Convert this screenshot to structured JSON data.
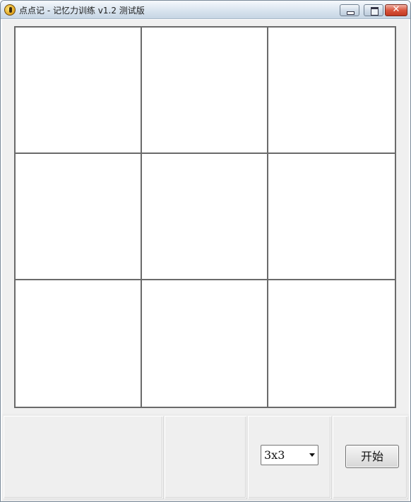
{
  "window": {
    "title": "点点记 - 记忆力训练 v1.2 测试版",
    "close_glyph": "✕"
  },
  "board": {
    "rows": 3,
    "cols": 3
  },
  "controls": {
    "grid_size": {
      "selected": "3x3"
    },
    "start_label": "开始"
  }
}
